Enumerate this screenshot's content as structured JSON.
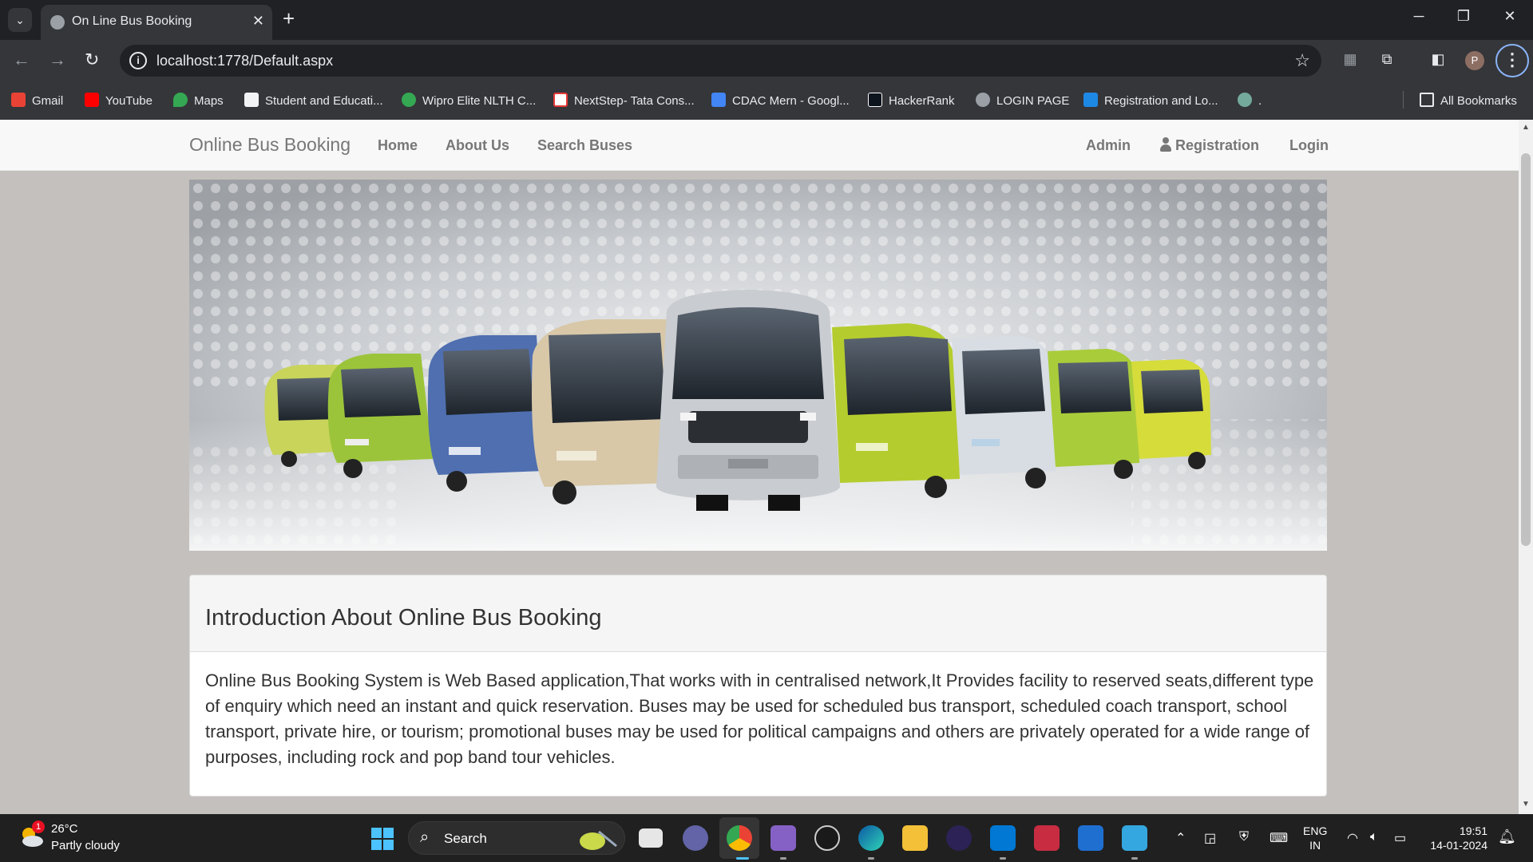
{
  "browser": {
    "tab_title": "On Line Bus Booking",
    "tab_close_glyph": "✕",
    "new_tab_glyph": "+",
    "url": "localhost:1778/Default.aspx",
    "profile_initial": "P",
    "bookmarks": [
      {
        "label": "Gmail",
        "icon": "gmail-icon",
        "color": "#ea4335"
      },
      {
        "label": "YouTube",
        "icon": "youtube-icon",
        "color": "#ff0000"
      },
      {
        "label": "Maps",
        "icon": "maps-icon",
        "color": "#34a853"
      },
      {
        "label": "Student and Educati...",
        "icon": "student-icon",
        "color": "#202124"
      },
      {
        "label": "Wipro Elite NLTH C...",
        "icon": "wipro-icon",
        "color": "#34a853"
      },
      {
        "label": "NextStep- Tata Cons...",
        "icon": "tcs-icon",
        "color": "#e53935"
      },
      {
        "label": "CDAC Mern - Googl...",
        "icon": "docs-icon",
        "color": "#4285f4"
      },
      {
        "label": "HackerRank",
        "icon": "hackerrank-icon",
        "color": "#1ba94c"
      },
      {
        "label": "LOGIN PAGE",
        "icon": "globe-icon",
        "color": "#9aa0a6"
      },
      {
        "label": "Registration and Lo...",
        "icon": "registration-icon",
        "color": "#1e88e5"
      },
      {
        "label": ".",
        "icon": "chatgpt-icon",
        "color": "#74aa9c"
      }
    ],
    "all_bookmarks": "All Bookmarks"
  },
  "site": {
    "brand": "Online Bus Booking",
    "nav_left": [
      "Home",
      "About Us",
      "Search Buses"
    ],
    "nav_admin": "Admin",
    "nav_registration": "Registration",
    "nav_login": "Login"
  },
  "intro": {
    "title": "Introduction About Online Bus Booking",
    "body": "Online Bus Booking System is Web Based application,That works with in centralised network,It Provides facility to reserved seats,different type of enquiry which need an instant and quick reservation. Buses may be used for scheduled bus transport, scheduled coach transport, school transport, private hire, or tourism; promotional buses may be used for political campaigns and others are privately operated for a wide range of purposes, including rock and pop band tour vehicles."
  },
  "taskbar": {
    "weather_badge": "1",
    "temperature": "26°C",
    "weather": "Partly cloudy",
    "search_label": "Search",
    "lang_line1": "ENG",
    "lang_line2": "IN",
    "time": "19:51",
    "date": "14-01-2024"
  },
  "colors": {
    "page_background": "#c4c0bd",
    "navbar_background": "#f8f8f8",
    "bus_green": "#a8c43a",
    "bus_blue": "#4f6fb0"
  }
}
